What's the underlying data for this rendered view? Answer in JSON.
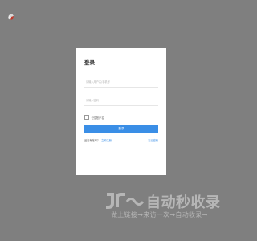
{
  "login": {
    "title": "登录",
    "username_placeholder": "请输入用户名/手机号",
    "password_placeholder": "请输入密码",
    "remember_label": "记住账户名",
    "submit_label": "登录",
    "no_account_text": "还没有账号？",
    "register_link": "立即注册",
    "forgot_link": "忘记密码"
  },
  "watermark": {
    "logo_icon": "jr-logo-icon",
    "main": "自动秒收录",
    "sub": "做上链接→来访一次→自动收录→"
  },
  "corner_logo_icon": "bird-logo-icon",
  "colors": {
    "background": "#7f7f7f",
    "accent": "#3a8ee6"
  }
}
